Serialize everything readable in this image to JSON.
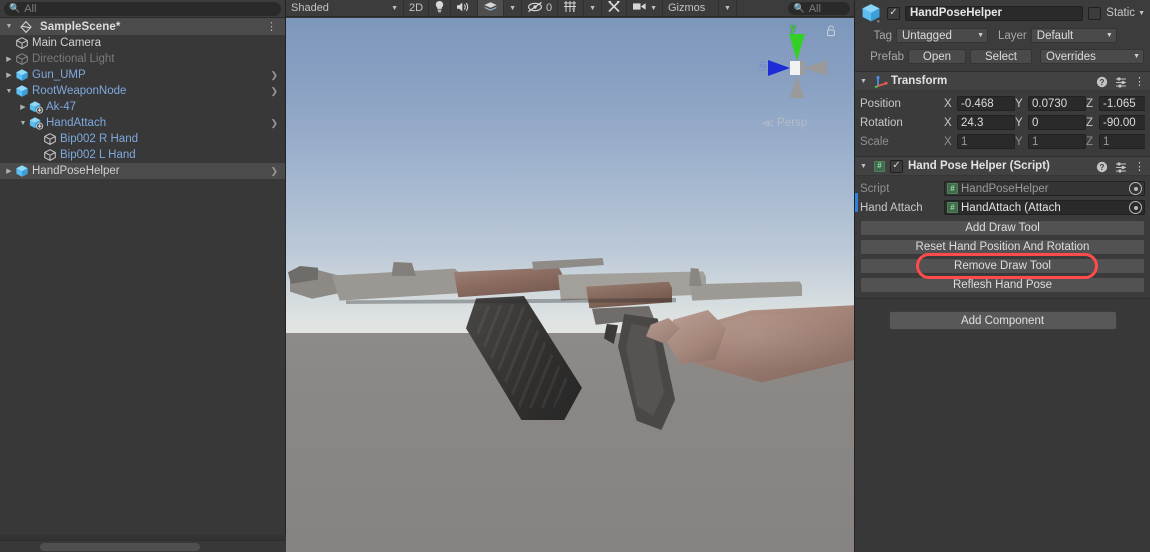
{
  "hierarchy": {
    "search": {
      "placeholder": "All",
      "icon": "search-icon"
    },
    "scene": {
      "label": "SampleScene*",
      "icon": "unity-scene-icon",
      "menu_icon": "kebab-menu-icon"
    },
    "items": [
      {
        "label": "Main Camera",
        "icon": "gameobject-cube-icon",
        "indent": 1,
        "twist": "",
        "color": "white",
        "chevron": false,
        "selected": false
      },
      {
        "label": "Directional Light",
        "icon": "gameobject-cube-icon",
        "indent": 1,
        "twist": "right",
        "color": "dim",
        "chevron": false,
        "selected": false
      },
      {
        "label": "Gun_UMP",
        "icon": "prefab-cube-icon",
        "indent": 1,
        "twist": "right",
        "color": "blue",
        "chevron": true,
        "selected": false
      },
      {
        "label": "RootWeaponNode",
        "icon": "prefab-cube-icon",
        "indent": 1,
        "twist": "down",
        "color": "blue",
        "chevron": true,
        "selected": false
      },
      {
        "label": "Ak-47",
        "icon": "prefab-variant-icon",
        "indent": 2,
        "twist": "right",
        "color": "blue",
        "chevron": false,
        "selected": false
      },
      {
        "label": "HandAttach",
        "icon": "prefab-variant-icon",
        "indent": 2,
        "twist": "down",
        "color": "blue",
        "chevron": true,
        "selected": false
      },
      {
        "label": "Bip002 R Hand",
        "icon": "gameobject-cube-icon",
        "indent": 3,
        "twist": "",
        "color": "blue",
        "chevron": false,
        "selected": false
      },
      {
        "label": "Bip002 L Hand",
        "icon": "gameobject-cube-icon",
        "indent": 3,
        "twist": "",
        "color": "blue",
        "chevron": false,
        "selected": false
      },
      {
        "label": "HandPoseHelper",
        "icon": "prefab-cube-icon",
        "indent": 1,
        "twist": "right",
        "color": "white",
        "chevron": true,
        "selected": true
      }
    ]
  },
  "scene_toolbar": {
    "draw_mode": "Shaded",
    "mode_2d": "2D",
    "lighting_icon": "lightbulb-icon",
    "audio_icon": "speaker-icon",
    "fx_icon": "fx-layers-icon",
    "fx_caret": "caret-down-icon",
    "hidden_count": "0",
    "hidden_icon": "eye-off-icon",
    "grid_icon": "grid-axis-icon",
    "grid_caret": "caret-down-icon",
    "tools_icon": "tools-icon",
    "camera_icon": "scene-camera-icon",
    "camera_caret": "caret-down-icon",
    "gizmos_label": "Gizmos",
    "gizmos_caret": "caret-down-icon",
    "search_placeholder": "All"
  },
  "scene_view": {
    "gizmo": {
      "y_axis": "y",
      "z_axis": "z",
      "projection": "Persp",
      "projection_prefix": "≪",
      "lock_icon": "lock-icon",
      "y_color": "#35d027",
      "z_color": "#1d2cd6",
      "gray_color": "#9a9a9a"
    },
    "colors": {
      "sky_top": "#7d97bc",
      "sky_horizon": "#e3e4e0",
      "ground": "#8a8785"
    }
  },
  "inspector": {
    "object": {
      "icon": "prefab-cube-icon",
      "enabled_checkbox": "✓",
      "name": "HandPoseHelper",
      "static_label": "Static",
      "static_caret": "caret-down-icon",
      "static_checkbox": ""
    },
    "tag_label": "Tag",
    "tag_value": "Untagged",
    "layer_label": "Layer",
    "layer_value": "Default",
    "prefab_label": "Prefab",
    "prefab_open": "Open",
    "prefab_select": "Select",
    "prefab_overrides": "Overrides",
    "transform": {
      "fold_icon": "caret-down-icon",
      "icon": "transform-axis-icon",
      "title": "Transform",
      "help_icon": "help-icon",
      "preset_icon": "preset-icon",
      "menu_icon": "kebab-menu-icon",
      "rows": [
        {
          "label": "Position",
          "dim": false,
          "x": "-0.468",
          "y": "0.0730",
          "z": "-1.065"
        },
        {
          "label": "Rotation",
          "dim": false,
          "x": "24.3",
          "y": "0",
          "z": "-90.00"
        },
        {
          "label": "Scale",
          "dim": true,
          "x": "1",
          "y": "1",
          "z": "1"
        }
      ],
      "axis_labels": [
        "X",
        "Y",
        "Z"
      ]
    },
    "script_component": {
      "fold_icon": "caret-down-icon",
      "icon": "cs-script-icon",
      "enabled_checkbox": "✓",
      "title": "Hand Pose Helper (Script)",
      "help_icon": "help-icon",
      "preset_icon": "preset-icon",
      "menu_icon": "kebab-menu-icon",
      "script_label": "Script",
      "script_value": "HandPoseHelper",
      "hand_attach_label": "Hand Attach",
      "hand_attach_value": "HandAttach (Attach",
      "picker_icon": "object-picker-icon",
      "buttons": [
        {
          "label": "Add Draw Tool",
          "highlighted": false
        },
        {
          "label": "Reset Hand Position And Rotation",
          "highlighted": false
        },
        {
          "label": "Remove Draw Tool",
          "highlighted": true
        },
        {
          "label": "Reflesh Hand Pose",
          "highlighted": false
        }
      ],
      "highlight_color": "#ff4b4b"
    },
    "add_component": "Add Component"
  }
}
